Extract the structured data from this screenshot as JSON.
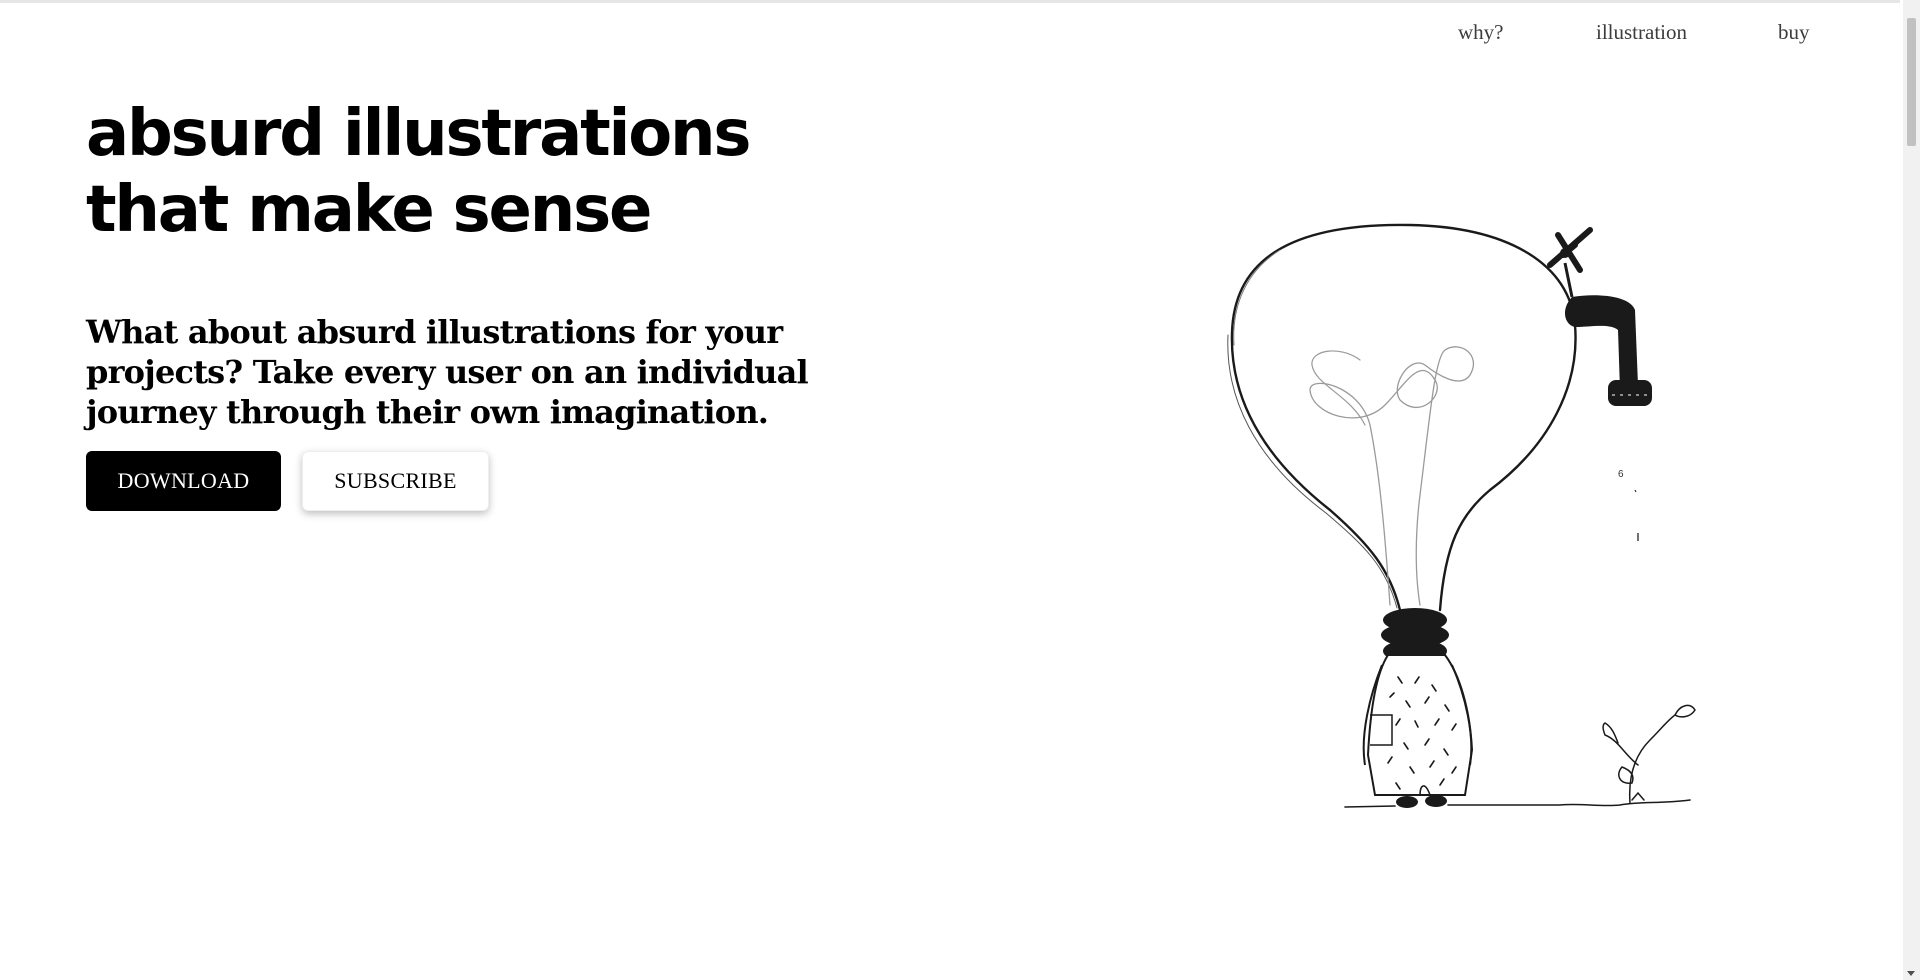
{
  "nav": {
    "items": [
      {
        "label": "why?"
      },
      {
        "label": "illustration"
      },
      {
        "label": "buy"
      }
    ]
  },
  "hero": {
    "title": "absurd illustrations that make sense",
    "subtitle": "What about absurd illustrations for your projects? Take every user on an individual journey through their own imagination."
  },
  "buttons": {
    "download_label": "DOWNLOAD",
    "subscribe_label": "SUBSCRIBE"
  },
  "illustration": {
    "icon": "lightbulb-person-illustration"
  },
  "colors": {
    "background": "#ffffff",
    "text": "#000000",
    "nav_text": "#3c3c3c",
    "primary_button": "#000000"
  }
}
